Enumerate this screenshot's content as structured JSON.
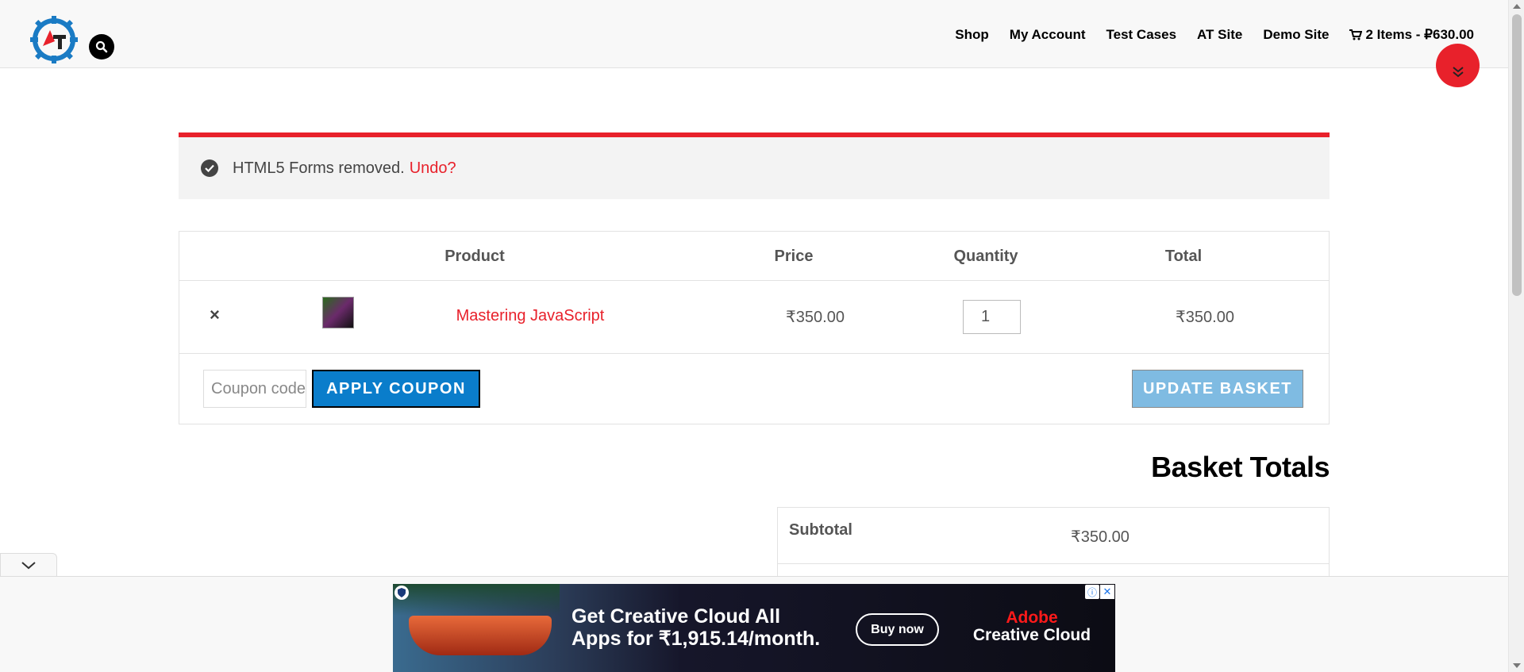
{
  "header": {
    "nav": [
      "Shop",
      "My Account",
      "Test Cases",
      "AT Site",
      "Demo Site"
    ],
    "cart_label": "2 Items - ₽630.00"
  },
  "notice": {
    "message": "HTML5 Forms removed.",
    "undo": "Undo?"
  },
  "cart": {
    "headers": {
      "product": "Product",
      "price": "Price",
      "quantity": "Quantity",
      "total": "Total"
    },
    "rows": [
      {
        "remove": "×",
        "name": "Mastering JavaScript",
        "price": "₹350.00",
        "quantity": "1",
        "total": "₹350.00"
      }
    ],
    "coupon_placeholder": "Coupon code",
    "apply_label": "APPLY COUPON",
    "update_label": "UPDATE BASKET"
  },
  "totals": {
    "title": "Basket Totals",
    "subtotal_label": "Subtotal",
    "subtotal_value": "₹350.00"
  },
  "ad": {
    "headline_line1": "Get Creative Cloud All",
    "headline_line2": "Apps for ₹1,915.14/month.",
    "cta": "Buy now",
    "brand_line1": "Adobe",
    "brand_line2": "Creative Cloud",
    "info_glyph": "ⓘ",
    "close_glyph": "✕"
  },
  "colors": {
    "accent": "#e8212b",
    "button_blue": "#0a7dcb",
    "button_disabled": "#7fbbe2"
  }
}
